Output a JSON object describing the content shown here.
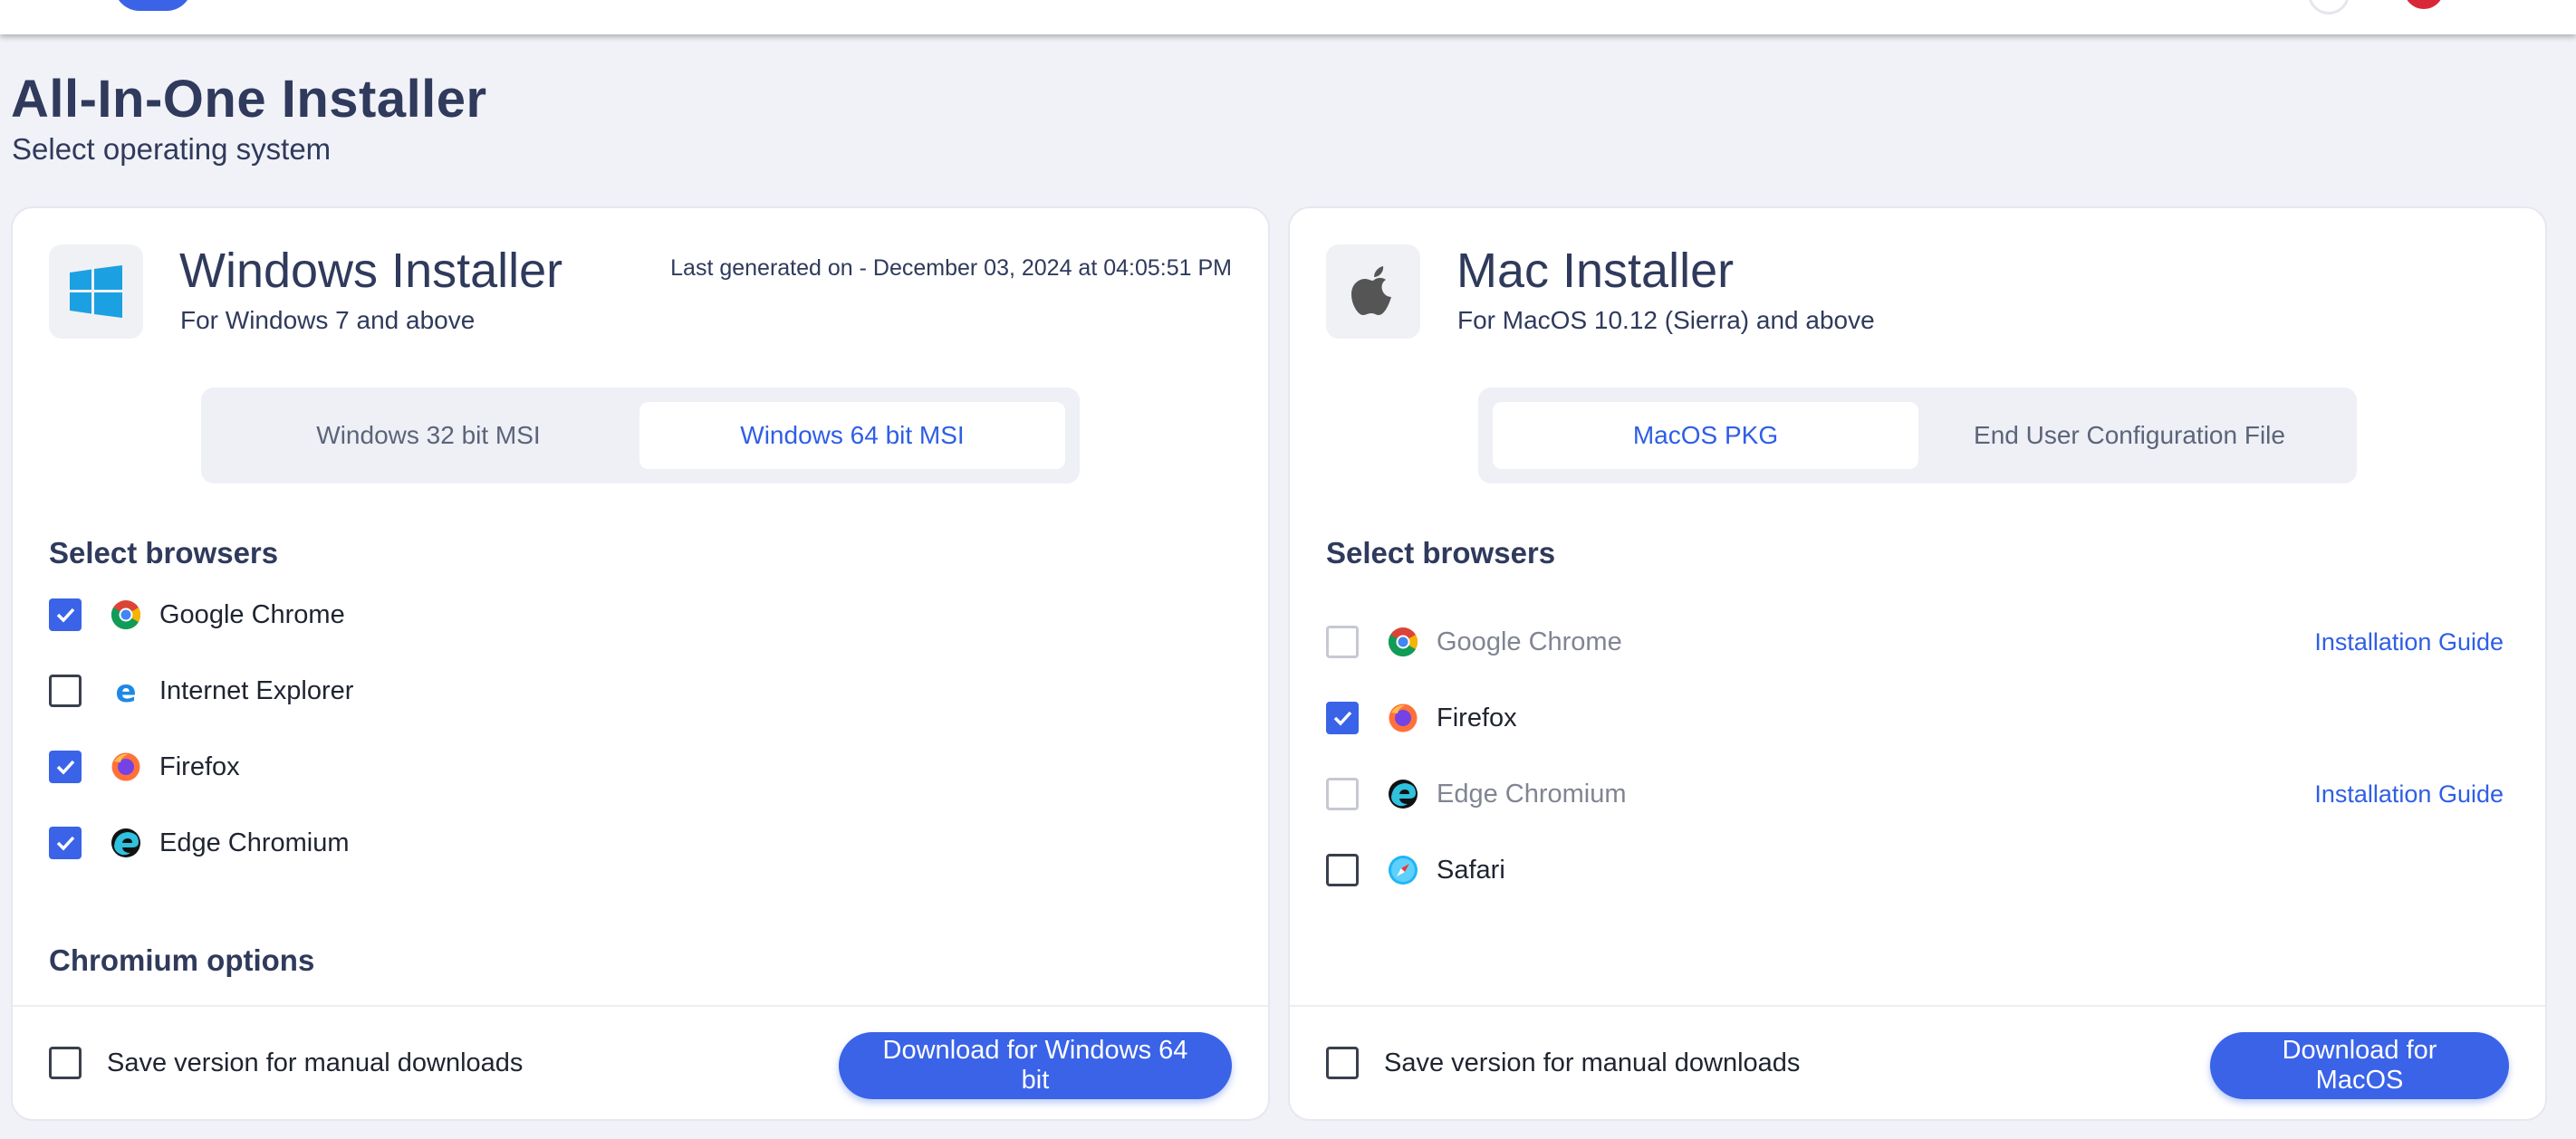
{
  "page": {
    "title": "All-In-One Installer",
    "subtitle": "Select operating system"
  },
  "windows": {
    "title": "Windows Installer",
    "subtitle": "For Windows 7 and above",
    "last_generated": "Last generated on - December 03, 2024 at 04:05:51 PM",
    "options": [
      "Windows 32 bit MSI",
      "Windows 64 bit MSI"
    ],
    "selected_option": "Windows 64 bit MSI",
    "browsers_heading": "Select browsers",
    "browsers": [
      {
        "label": "Google Chrome",
        "checked": true,
        "icon": "chrome-icon"
      },
      {
        "label": "Internet Explorer",
        "checked": false,
        "icon": "internet-explorer-icon"
      },
      {
        "label": "Firefox",
        "checked": true,
        "icon": "firefox-icon"
      },
      {
        "label": "Edge Chromium",
        "checked": true,
        "icon": "edge-icon"
      }
    ],
    "chromium_heading": "Chromium options",
    "save_version_label": "Save version for manual downloads",
    "save_version_checked": false,
    "download_label": "Download for Windows 64 bit"
  },
  "mac": {
    "title": "Mac Installer",
    "subtitle": "For MacOS 10.12 (Sierra) and above",
    "options": [
      "MacOS PKG",
      "End User Configuration File"
    ],
    "selected_option": "MacOS PKG",
    "browsers_heading": "Select browsers",
    "browsers": [
      {
        "label": "Google Chrome",
        "checked": false,
        "disabled": true,
        "icon": "chrome-icon",
        "guide": "Installation Guide"
      },
      {
        "label": "Firefox",
        "checked": true,
        "disabled": false,
        "icon": "firefox-icon"
      },
      {
        "label": "Edge Chromium",
        "checked": false,
        "disabled": true,
        "icon": "edge-icon",
        "guide": "Installation Guide"
      },
      {
        "label": "Safari",
        "checked": false,
        "disabled": false,
        "icon": "safari-icon"
      }
    ],
    "save_version_label": "Save version for manual downloads",
    "save_version_checked": false,
    "download_label": "Download for MacOS"
  },
  "colors": {
    "accent": "#3a63e8",
    "heading": "#2f3a5c",
    "background": "#f1f2f7"
  }
}
